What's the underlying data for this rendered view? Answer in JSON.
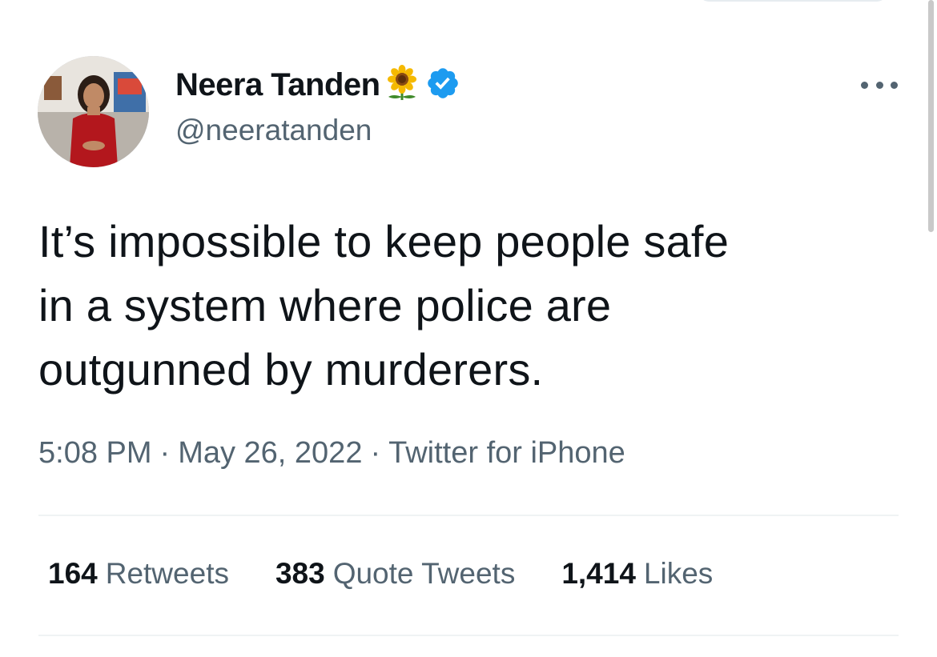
{
  "author": {
    "display_name": "Neera Tanden",
    "handle": "@neeratanden",
    "emoji_icon": "sunflower-icon",
    "verified_icon": "verified-badge-icon",
    "verified_color": "#1d9bf0"
  },
  "tweet": {
    "text_lines": [
      "It’s impossible to keep people safe",
      "in a system where police are",
      "outgunned by murderers."
    ]
  },
  "meta": {
    "time": "5:08 PM",
    "date": "May 26, 2022",
    "source": "Twitter for iPhone",
    "separator": "·"
  },
  "stats": {
    "retweets_count": "164",
    "retweets_label": "Retweets",
    "quotes_count": "383",
    "quotes_label": "Quote Tweets",
    "likes_count": "1,414",
    "likes_label": "Likes"
  },
  "colors": {
    "text_primary": "#0f1419",
    "text_secondary": "#536471",
    "divider": "#eff3f4"
  }
}
